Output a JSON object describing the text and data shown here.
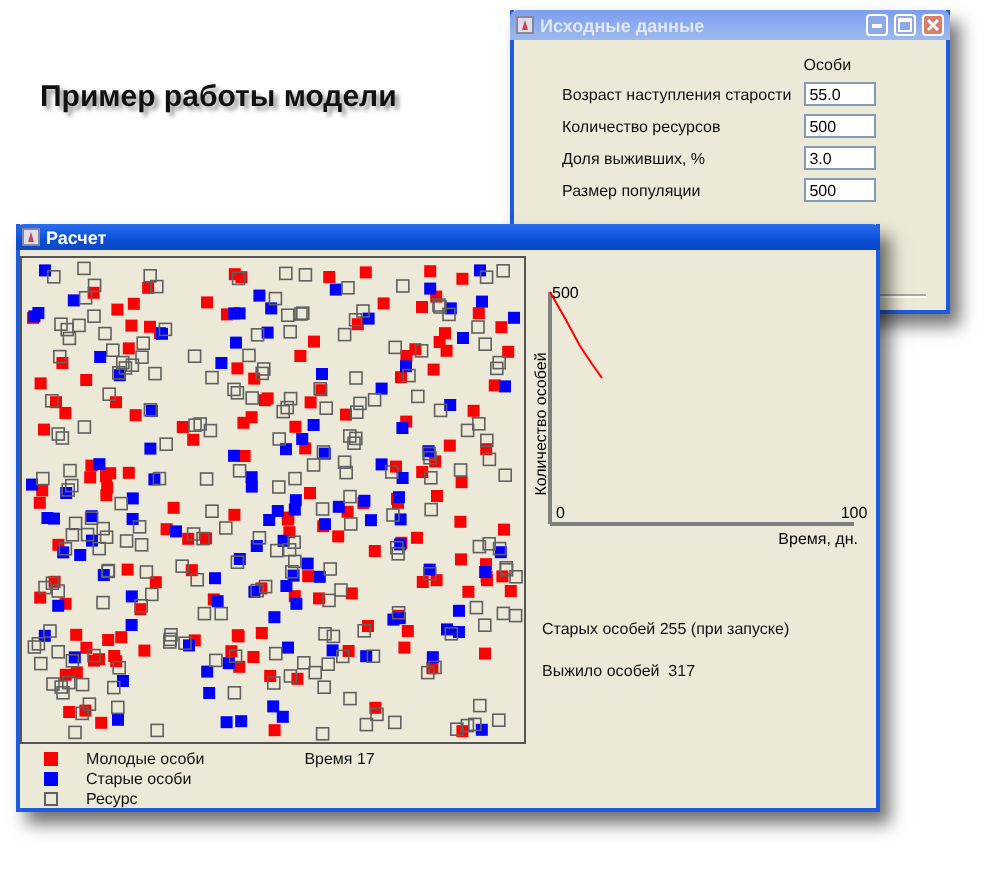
{
  "heading": "Пример работы модели",
  "input_window": {
    "title": "Исходные данные",
    "column_header": "Особи",
    "fields": [
      {
        "label": "Возраст наступления старости",
        "value": "55.0"
      },
      {
        "label": "Количество ресурсов",
        "value": "500"
      },
      {
        "label": "Доля выживших, %",
        "value": "3.0"
      },
      {
        "label": "Размер популяции",
        "value": "500"
      }
    ]
  },
  "simulation_window": {
    "title": "Расчет",
    "legend": [
      {
        "label": "Молодые особи",
        "kind": "filled",
        "color": "#ff0000"
      },
      {
        "label": "Старые особи",
        "kind": "filled",
        "color": "#0000ff"
      },
      {
        "label": "Ресурс",
        "kind": "outline",
        "color": "#606060"
      }
    ],
    "time": "Время 17",
    "plot": {
      "y_top_label": "500",
      "x_start_label": "0",
      "x_end_label": "100",
      "x_axis_title": "Время, дн.",
      "y_axis_title": "Количество особей"
    },
    "stats": [
      "Старых особей 255 (при запуске)",
      "Выжило особей  317"
    ]
  }
}
